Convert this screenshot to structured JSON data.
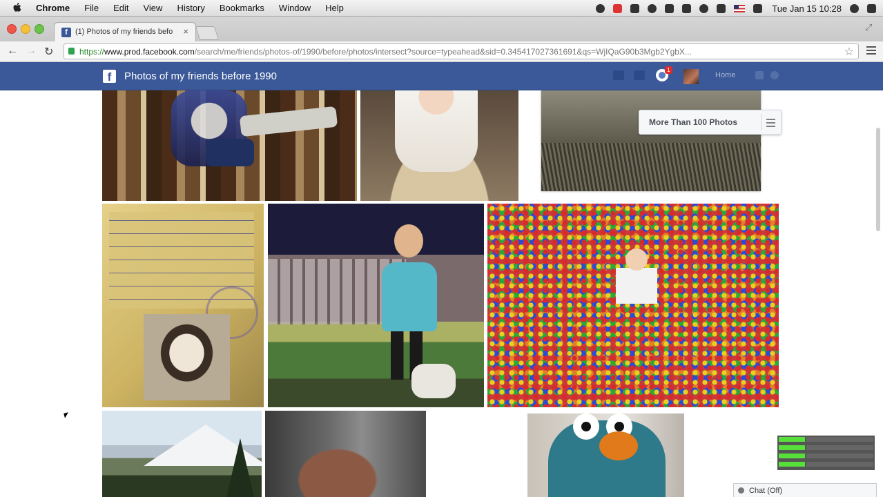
{
  "menubar": {
    "apple": "",
    "items": [
      "Chrome",
      "File",
      "Edit",
      "View",
      "History",
      "Bookmarks",
      "Window",
      "Help"
    ],
    "clock": "Tue Jan 15  10:28"
  },
  "browser": {
    "tab_title": "(1) Photos of my friends befo",
    "tab_close": "×",
    "nav": {
      "back": "←",
      "forward": "→",
      "reload": "↻"
    },
    "url": {
      "scheme": "https://",
      "host": "www.prod.facebook.com",
      "path": "/search/me/friends/photos-of/1990/before/photos/intersect?source=typeahead&sid=0.345417027361691&qs=WjIQaG90b3Mgb2YgbX..."
    },
    "star": "☆",
    "fullscreen": "⤢"
  },
  "facebook": {
    "logo": "f",
    "page_title": "Photos of my friends before 1990",
    "globe_badge": "1",
    "home_label": "Home",
    "more_photos_label": "More Than 100 Photos"
  },
  "chat": {
    "label": "Chat (Off)"
  },
  "colors": {
    "facebook_blue": "#3b5998",
    "meter_green": "#58e03a",
    "notification_red": "#e02b2b"
  }
}
